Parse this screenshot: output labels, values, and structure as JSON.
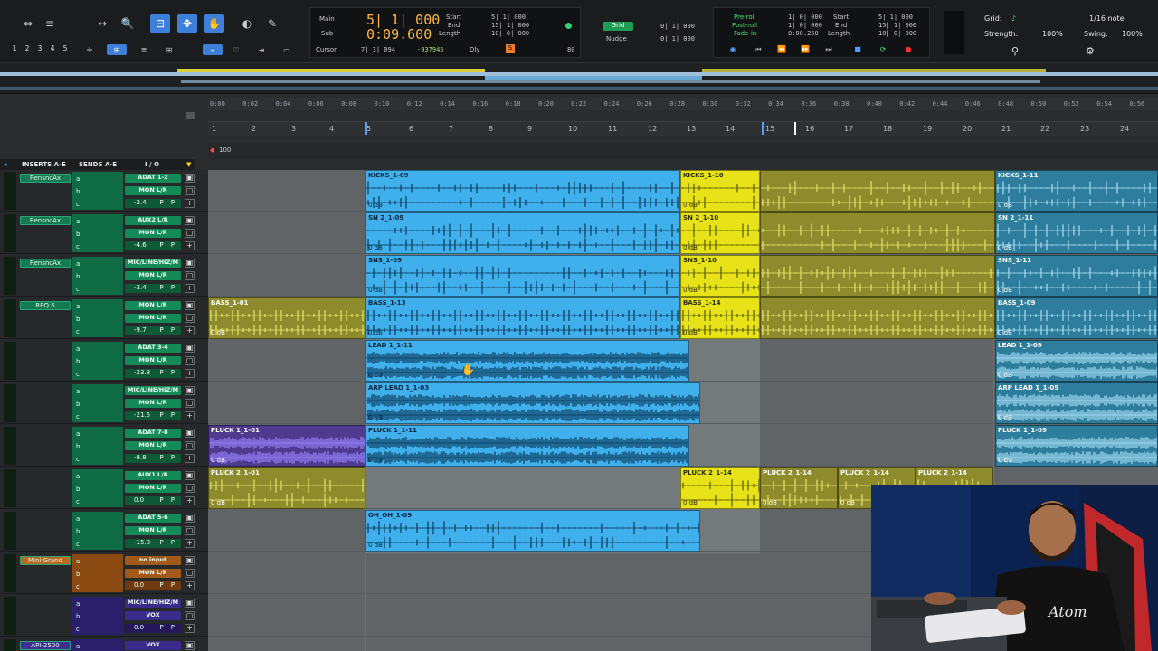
{
  "toolbar": {
    "track_numbers": [
      "1",
      "2",
      "3",
      "4",
      "5"
    ]
  },
  "counter": {
    "main_label": "Main",
    "main_value": "5| 1| 000",
    "sub_label": "Sub",
    "sub_value": "0:09.600",
    "cursor_label": "Cursor",
    "cursor_value": "7| 3| 094",
    "sample_value": "-937945",
    "start_label": "Start",
    "end_label": "End",
    "length_label": "Length",
    "start_value": "5| 1| 000",
    "end_value": "15| 1| 000",
    "length_value": "10| 0| 000",
    "dly_label": "Dly",
    "tempo_value": "80"
  },
  "grid": {
    "grid_label": "Grid",
    "grid_value": "0| 1| 000",
    "nudge_label": "Nudge",
    "nudge_value": "0| 1| 000"
  },
  "transport": {
    "preroll_label": "Pre-roll",
    "postroll_label": "Post-roll",
    "fadein_label": "Fade-in",
    "preroll_value": "1| 0| 000",
    "postroll_value": "1| 0| 000",
    "fadein_value": "0:00.250",
    "start_label": "Start",
    "end_label": "End",
    "length_label": "Length",
    "start_value": "5| 1| 000",
    "end_value": "15| 1| 000",
    "length_value": "10| 0| 000"
  },
  "right_panel": {
    "grid_label": "Grid:",
    "grid_value": "1/16 note",
    "strength_label": "Strength:",
    "strength_value": "100%",
    "swing_label": "Swing:",
    "swing_value": "100%"
  },
  "ruler": {
    "time_ticks": [
      "0:00",
      "0:02",
      "0:04",
      "0:06",
      "0:08",
      "0:10",
      "0:12",
      "0:14",
      "0:16",
      "0:18",
      "0:20",
      "0:22",
      "0:24",
      "0:26",
      "0:28",
      "0:30",
      "0:32",
      "0:34",
      "0:36",
      "0:38",
      "0:40",
      "0:42",
      "0:44",
      "0:46",
      "0:48",
      "0:50",
      "0:52",
      "0:54",
      "0:56"
    ],
    "bar_numbers": [
      "1",
      "2",
      "3",
      "4",
      "5",
      "6",
      "7",
      "8",
      "9",
      "10",
      "11",
      "12",
      "13",
      "14",
      "15",
      "16",
      "17",
      "18",
      "19",
      "20",
      "21",
      "22",
      "23",
      "24"
    ],
    "tempo_marker": "100"
  },
  "mix_header": {
    "inserts": "INSERTS A-E",
    "sends": "SENDS A-E",
    "io": "I / O"
  },
  "tracks": [
    {
      "insert": "RensncAx",
      "io_in": "ADAT 1-2",
      "io_out": "MON L/R",
      "volume": "-3.4",
      "pan": "P P"
    },
    {
      "insert": "RensncAx",
      "io_in": "AUX2 L/R",
      "io_out": "MON L/R",
      "volume": "-4.6",
      "pan": "P P"
    },
    {
      "insert": "RensncAx",
      "io_in": "MIC/LINE/HIZ/M",
      "io_out": "MON L/R",
      "volume": "-3.4",
      "pan": "P P"
    },
    {
      "insert": "REQ 6",
      "io_in": "MON L/R",
      "io_out": "MON L/R",
      "volume": "-9.7",
      "pan": "P P"
    },
    {
      "insert": "",
      "io_in": "ADAT 3-4",
      "io_out": "MON L/R",
      "volume": "-23.8",
      "pan": "P P"
    },
    {
      "insert": "",
      "io_in": "MIC/LINE/HIZ/M",
      "io_out": "MON L/R",
      "volume": "-21.5",
      "pan": "P P"
    },
    {
      "insert": "",
      "io_in": "ADAT 7-8",
      "io_out": "MON L/R",
      "volume": "-8.8",
      "pan": "P P"
    },
    {
      "insert": "",
      "io_in": "AUX1 L/R",
      "io_out": "MON L/R",
      "volume": "0.0",
      "pan": "P P"
    },
    {
      "insert": "",
      "io_in": "ADAT 5-6",
      "io_out": "MON L/R",
      "volume": "-15.8",
      "pan": "P P"
    },
    {
      "insert": "Mini Grand",
      "io_in": "no input",
      "io_out": "MON L/R",
      "volume": "0.0",
      "pan": "P P"
    },
    {
      "insert": "",
      "io_in": "MIC/LINE/HIZ/M",
      "io_out": "VOX",
      "volume": "0.0",
      "pan": "P P"
    },
    {
      "insert": "API-2500",
      "io_in": "VOX",
      "io_out": "",
      "volume": "",
      "pan": ""
    }
  ],
  "send_letters": [
    "a",
    "b",
    "c"
  ],
  "clips": [
    {
      "lane": 0,
      "name": "KICKS_1-09",
      "color": "blue",
      "db": "0 dB"
    },
    {
      "lane": 0,
      "name": "KICKS_1-10",
      "color": "yellow",
      "db": "0 dB"
    },
    {
      "lane": 0,
      "name": "",
      "color": "olive",
      "db": ""
    },
    {
      "lane": 0,
      "name": "KICKS_1-11",
      "color": "teal",
      "db": "0 dB"
    },
    {
      "lane": 1,
      "name": "SN 2_1-09",
      "color": "blue",
      "db": "0 dB"
    },
    {
      "lane": 1,
      "name": "SN 2_1-10",
      "color": "yellow",
      "db": "0 dB"
    },
    {
      "lane": 1,
      "name": "",
      "color": "olive",
      "db": ""
    },
    {
      "lane": 1,
      "name": "SN 2_1-11",
      "color": "teal",
      "db": "0 dB"
    },
    {
      "lane": 2,
      "name": "SNS_1-09",
      "color": "blue",
      "db": "0 dB"
    },
    {
      "lane": 2,
      "name": "SNS_1-10",
      "color": "yellow",
      "db": "0 dB"
    },
    {
      "lane": 2,
      "name": "",
      "color": "olive",
      "db": ""
    },
    {
      "lane": 2,
      "name": "SNS_1-11",
      "color": "teal",
      "db": "0 dB"
    },
    {
      "lane": 3,
      "name": "BASS_1-01",
      "color": "olive",
      "db": "0 dB"
    },
    {
      "lane": 3,
      "name": "BASS_1-13",
      "color": "blue",
      "db": "0 dB"
    },
    {
      "lane": 3,
      "name": "BASS_1-14",
      "color": "yellow",
      "db": "0 dB"
    },
    {
      "lane": 3,
      "name": "",
      "color": "olive",
      "db": ""
    },
    {
      "lane": 3,
      "name": "BASS_1-09",
      "color": "teal",
      "db": "0 dB"
    },
    {
      "lane": 4,
      "name": "LEAD 1_1-11",
      "color": "blue",
      "db": "0 dB"
    },
    {
      "lane": 4,
      "name": "LEAD 1_1-09",
      "color": "teal",
      "db": "0 dB"
    },
    {
      "lane": 5,
      "name": "ARP LEAD 1_1-03",
      "color": "blue",
      "db": "0 dB"
    },
    {
      "lane": 5,
      "name": "ARP LEAD 1_1-05",
      "color": "teal",
      "db": "0 dB"
    },
    {
      "lane": 6,
      "name": "PLUCK 1_1-01",
      "color": "purple",
      "db": "0 dB"
    },
    {
      "lane": 6,
      "name": "PLUCK 1_1-11",
      "color": "blue",
      "db": "0 dB"
    },
    {
      "lane": 6,
      "name": "PLUCK 1_1-09",
      "color": "teal",
      "db": "0 dB"
    },
    {
      "lane": 7,
      "name": "PLUCK 2_1-01",
      "color": "olive",
      "db": "0 dB"
    },
    {
      "lane": 7,
      "name": "PLUCK 2_1-14",
      "color": "yellow",
      "db": "0 dB"
    },
    {
      "lane": 7,
      "name": "PLUCK 2_1-14",
      "color": "olive",
      "db": "0 dB"
    },
    {
      "lane": 7,
      "name": "PLUCK 2_1-14",
      "color": "olive",
      "db": "0 dB"
    },
    {
      "lane": 7,
      "name": "PLUCK 2_1-14",
      "color": "olive",
      "db": ""
    },
    {
      "lane": 8,
      "name": "OH_OH_1-09",
      "color": "blue",
      "db": "0 dB"
    }
  ],
  "colors": {
    "clip_blue": "#3fb0ec",
    "clip_yellow": "#e8e318",
    "clip_olive": "#8d8b2c",
    "clip_teal": "#2f7d9d",
    "clip_purple": "#4e3a8f",
    "counter_orange": "#ffb940",
    "strip_green": "#148a58",
    "accent_blue": "#3d7fd9"
  }
}
